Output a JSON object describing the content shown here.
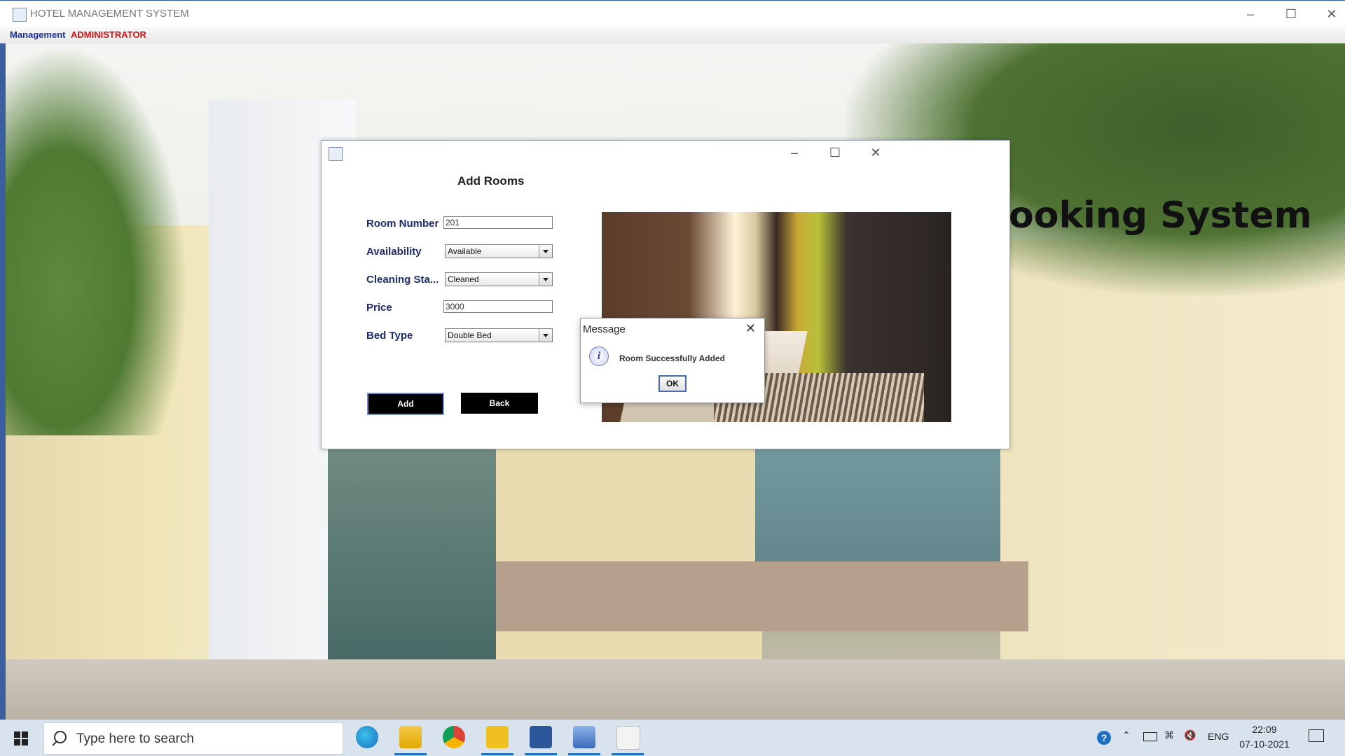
{
  "window": {
    "title": "HOTEL MANAGEMENT SYSTEM"
  },
  "menubar": {
    "item1": "Management",
    "item2": "ADMINISTRATOR"
  },
  "background": {
    "title_text": "ooking System"
  },
  "dialog": {
    "title": "Add Rooms",
    "fields": {
      "room_number": {
        "label": "Room Number",
        "value": "201"
      },
      "availability": {
        "label": "Availability",
        "value": "Available"
      },
      "cleaning_status": {
        "label": "Cleaning Sta...",
        "value": "Cleaned"
      },
      "price": {
        "label": "Price",
        "value": "3000"
      },
      "bed_type": {
        "label": "Bed Type",
        "value": "Double Bed"
      }
    },
    "buttons": {
      "add": "Add",
      "back": "Back"
    }
  },
  "message": {
    "title": "Message",
    "text": "Room Successfully Added",
    "ok": "OK",
    "icon": "info-icon"
  },
  "taskbar": {
    "search_placeholder": "Type here to search",
    "language": "ENG",
    "time": "22:09",
    "date": "07-10-2021"
  }
}
